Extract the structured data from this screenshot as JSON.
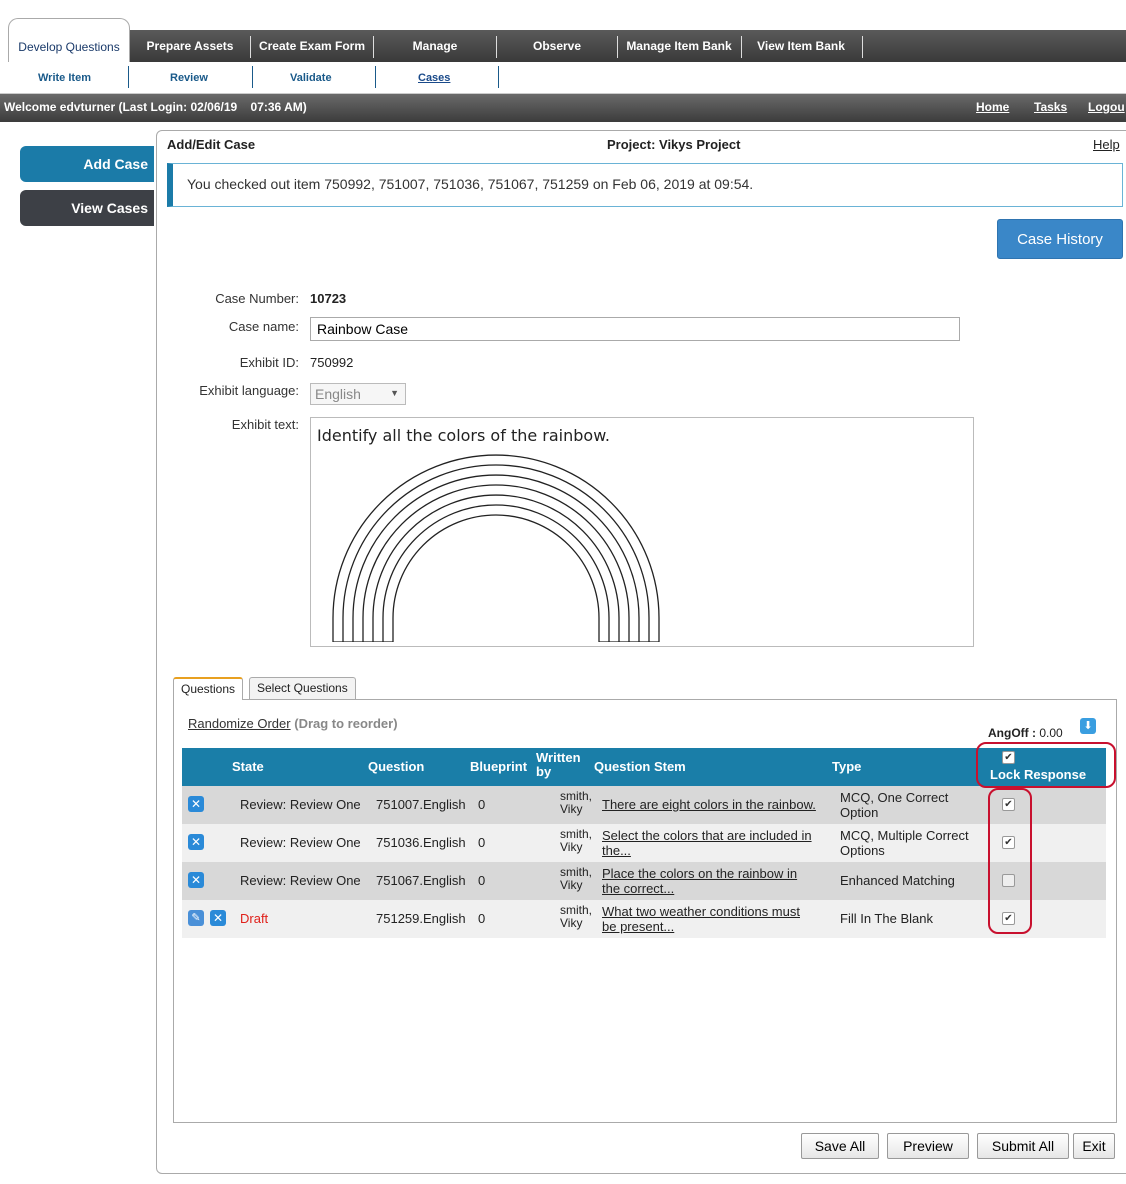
{
  "tabs": [
    {
      "label": "Develop Questions"
    },
    {
      "label": "Prepare Assets"
    },
    {
      "label": "Create Exam Form"
    },
    {
      "label": "Manage"
    },
    {
      "label": "Observe"
    },
    {
      "label": "Manage Item Bank"
    },
    {
      "label": "View Item Bank"
    }
  ],
  "subtabs": [
    {
      "label": "Write Item"
    },
    {
      "label": "Review"
    },
    {
      "label": "Validate"
    },
    {
      "label": "Cases"
    }
  ],
  "welcome": "Welcome edvturner (Last Login: 02/06/19    07:36 AM)",
  "toplinks": {
    "home": "Home",
    "tasks": "Tasks",
    "logout": "Logou"
  },
  "sidebar": {
    "add_case": "Add Case",
    "view_cases": "View Cases"
  },
  "panel": {
    "title": "Add/Edit Case",
    "project": "Project: Vikys Project",
    "help": "Help",
    "notice": "You checked out item 750992, 751007, 751036, 751067, 751259 on Feb 06, 2019 at 09:54.",
    "case_history": "Case History"
  },
  "form": {
    "case_number_label": "Case Number:",
    "case_number": "10723",
    "case_name_label": "Case name:",
    "case_name": "Rainbow Case",
    "exhibit_id_label": "Exhibit ID:",
    "exhibit_id": "750992",
    "exhibit_language_label": "Exhibit language:",
    "exhibit_language": "English",
    "exhibit_text_label": "Exhibit text:",
    "exhibit_text": "Identify all the colors of the rainbow."
  },
  "qtabs": {
    "questions": "Questions",
    "select_questions": "Select Questions"
  },
  "questions_section": {
    "randomize": "Randomize Order",
    "drag_hint": "(Drag to reorder)",
    "angoff_label": "AngOff :",
    "angoff_value": "0.00",
    "lock_response_checked": true
  },
  "table": {
    "headers": {
      "state": "State",
      "question": "Question",
      "blueprint": "Blueprint",
      "written_by_1": "Written",
      "written_by_2": "by",
      "stem": "Question Stem",
      "type": "Type",
      "lock": "Lock Response"
    },
    "rows": [
      {
        "state": "Review: Review One",
        "question": "751007.English",
        "blueprint": "0",
        "writer_1": "smith,",
        "writer_2": "Viky",
        "stem_1": "There are eight colors in the rainbow.",
        "stem_2": "",
        "type_1": "MCQ, One Correct",
        "type_2": "Option",
        "locked": true,
        "draft": false
      },
      {
        "state": "Review: Review One",
        "question": "751036.English",
        "blueprint": "0",
        "writer_1": "smith,",
        "writer_2": "Viky",
        "stem_1": "Select the colors that are included in",
        "stem_2": "the...",
        "type_1": "MCQ, Multiple Correct",
        "type_2": "Options",
        "locked": true,
        "draft": false
      },
      {
        "state": "Review: Review One",
        "question": "751067.English",
        "blueprint": "0",
        "writer_1": "smith,",
        "writer_2": "Viky",
        "stem_1": "Place the colors on the rainbow in",
        "stem_2": "the correct...",
        "type_1": "Enhanced Matching",
        "type_2": "",
        "locked": false,
        "draft": false
      },
      {
        "state": "Draft",
        "question": "751259.English",
        "blueprint": "0",
        "writer_1": "smith,",
        "writer_2": "Viky",
        "stem_1": "What two weather conditions must",
        "stem_2": "be present...",
        "type_1": "Fill In The Blank",
        "type_2": "",
        "locked": true,
        "draft": true
      }
    ]
  },
  "buttons": {
    "save_all": "Save All",
    "preview": "Preview",
    "submit_all": "Submit All",
    "exit": "Exit"
  },
  "colors": {
    "accent": "#1a7ea8",
    "highlight": "#c8102e",
    "draft": "#e0201a"
  }
}
